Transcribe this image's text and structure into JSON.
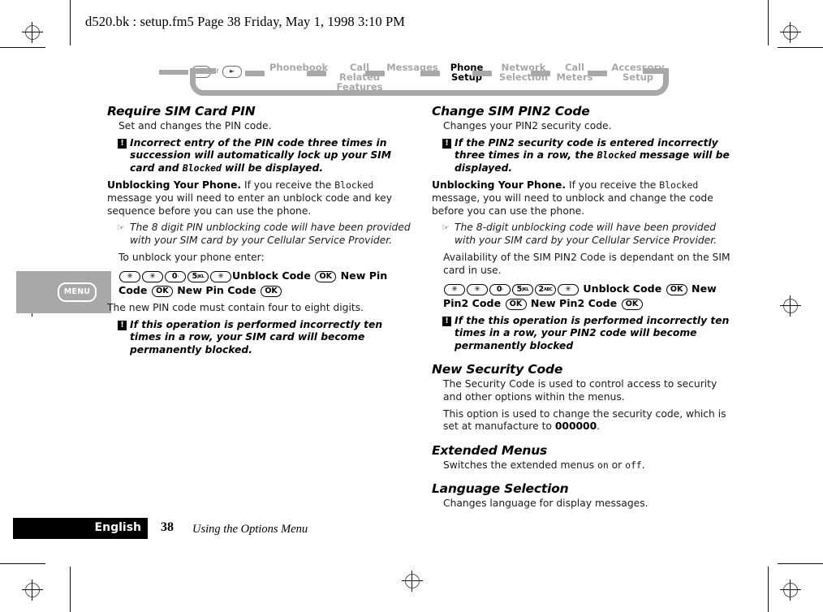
{
  "header": {
    "running_head": "d520.bk : setup.fm5  Page 38  Friday, May 1, 1998  3:10 PM"
  },
  "nav": {
    "or_label": "or",
    "left_key": "◄",
    "right_key": "►",
    "items": [
      {
        "label": "Phonebook",
        "active": false
      },
      {
        "label": "Call Related\nFeatures",
        "active": false
      },
      {
        "label": "Messages",
        "active": false
      },
      {
        "label": "Phone\nSetup",
        "active": true
      },
      {
        "label": "Network\nSelection",
        "active": false
      },
      {
        "label": "Call\nMeters",
        "active": false
      },
      {
        "label": "Accessory\nSetup",
        "active": false
      }
    ]
  },
  "margin": {
    "menu_key_label": "MENU"
  },
  "left_column": {
    "heading": "Require SIM Card PIN",
    "intro": "Set and changes the PIN code.",
    "warn1_a": "Incorrect entry of the PIN code three times in succession will automatically lock up your SIM card and ",
    "warn1_mono": "Blocked",
    "warn1_b": " will be displayed.",
    "unblock_label": "Unblocking Your Phone.",
    "unblock_a": " If you receive the ",
    "unblock_mono": "Blocked",
    "unblock_b": " message you will need to enter an unblock code and key sequence before you can use the phone.",
    "tip1": "The 8 digit PIN unblocking code will have been provided with your SIM card by your Cellular Service Provider.",
    "to_unblock": "To unblock your phone enter:",
    "sequence": {
      "keys": [
        {
          "main": "✳",
          "sup": ""
        },
        {
          "main": "✳",
          "sup": ""
        },
        {
          "main": "0",
          "sup": "·"
        },
        {
          "main": "5",
          "sup": "JKL"
        },
        {
          "main": "✳",
          "sup": ""
        }
      ],
      "text1": "Unblock Code",
      "ok1": "OK",
      "text2": "New Pin Code",
      "ok2": "OK",
      "text3": "New Pin Code",
      "ok3": "OK"
    },
    "digits_note": "The new PIN code must contain four to eight digits.",
    "warn2": "If this operation is performed incorrectly ten times in a row, your SIM card will become permanently blocked."
  },
  "right_column": {
    "heading1": "Change SIM PIN2 Code",
    "intro1": "Changes your PIN2 security code.",
    "warn1_a": "If the PIN2 security code is entered incorrectly three times in a row, the ",
    "warn1_mono": "Blocked",
    "warn1_b": " message will be displayed.",
    "unblock_label": "Unblocking Your Phone.",
    "unblock_a": " If you receive the ",
    "unblock_mono": "Blocked",
    "unblock_b": "  message, you will need to unblock and change the code before you can use the phone.",
    "tip1": "The 8-digit unblocking code will have been provided with your SIM card by your Cellular Service Provider.",
    "availability": "Availability of the SIM PIN2 Code is dependant on the SIM card in use.",
    "sequence": {
      "keys": [
        {
          "main": "✳",
          "sup": ""
        },
        {
          "main": "✳",
          "sup": ""
        },
        {
          "main": "0",
          "sup": "·"
        },
        {
          "main": "5",
          "sup": "JKL"
        },
        {
          "main": "2",
          "sup": "ABC"
        },
        {
          "main": "✳",
          "sup": ""
        }
      ],
      "text1": "Unblock Code",
      "ok1": "OK",
      "text2": "New Pin2 Code",
      "ok2": "OK",
      "text3": "New Pin2 Code",
      "ok3": "OK"
    },
    "warn2": "If the this operation is performed incorrectly ten times in a row, your PIN2 code will become permanently blocked",
    "heading2": "New Security Code",
    "sec_p1": "The Security Code is used to control access to security and other options within the menus.",
    "sec_p2_a": "This option is used to change the security code, which is set at manufacture to ",
    "sec_p2_code": "000000",
    "sec_p2_b": ".",
    "heading3": "Extended Menus",
    "ext_a": "Switches the extended menus ",
    "ext_on": "on",
    "ext_mid": " or ",
    "ext_off": "off",
    "ext_b": ".",
    "heading4": "Language Selection",
    "lang_p": "Changes language for display messages."
  },
  "footer": {
    "language": "English",
    "page_number": "38",
    "section_title": "Using the Options Menu"
  }
}
